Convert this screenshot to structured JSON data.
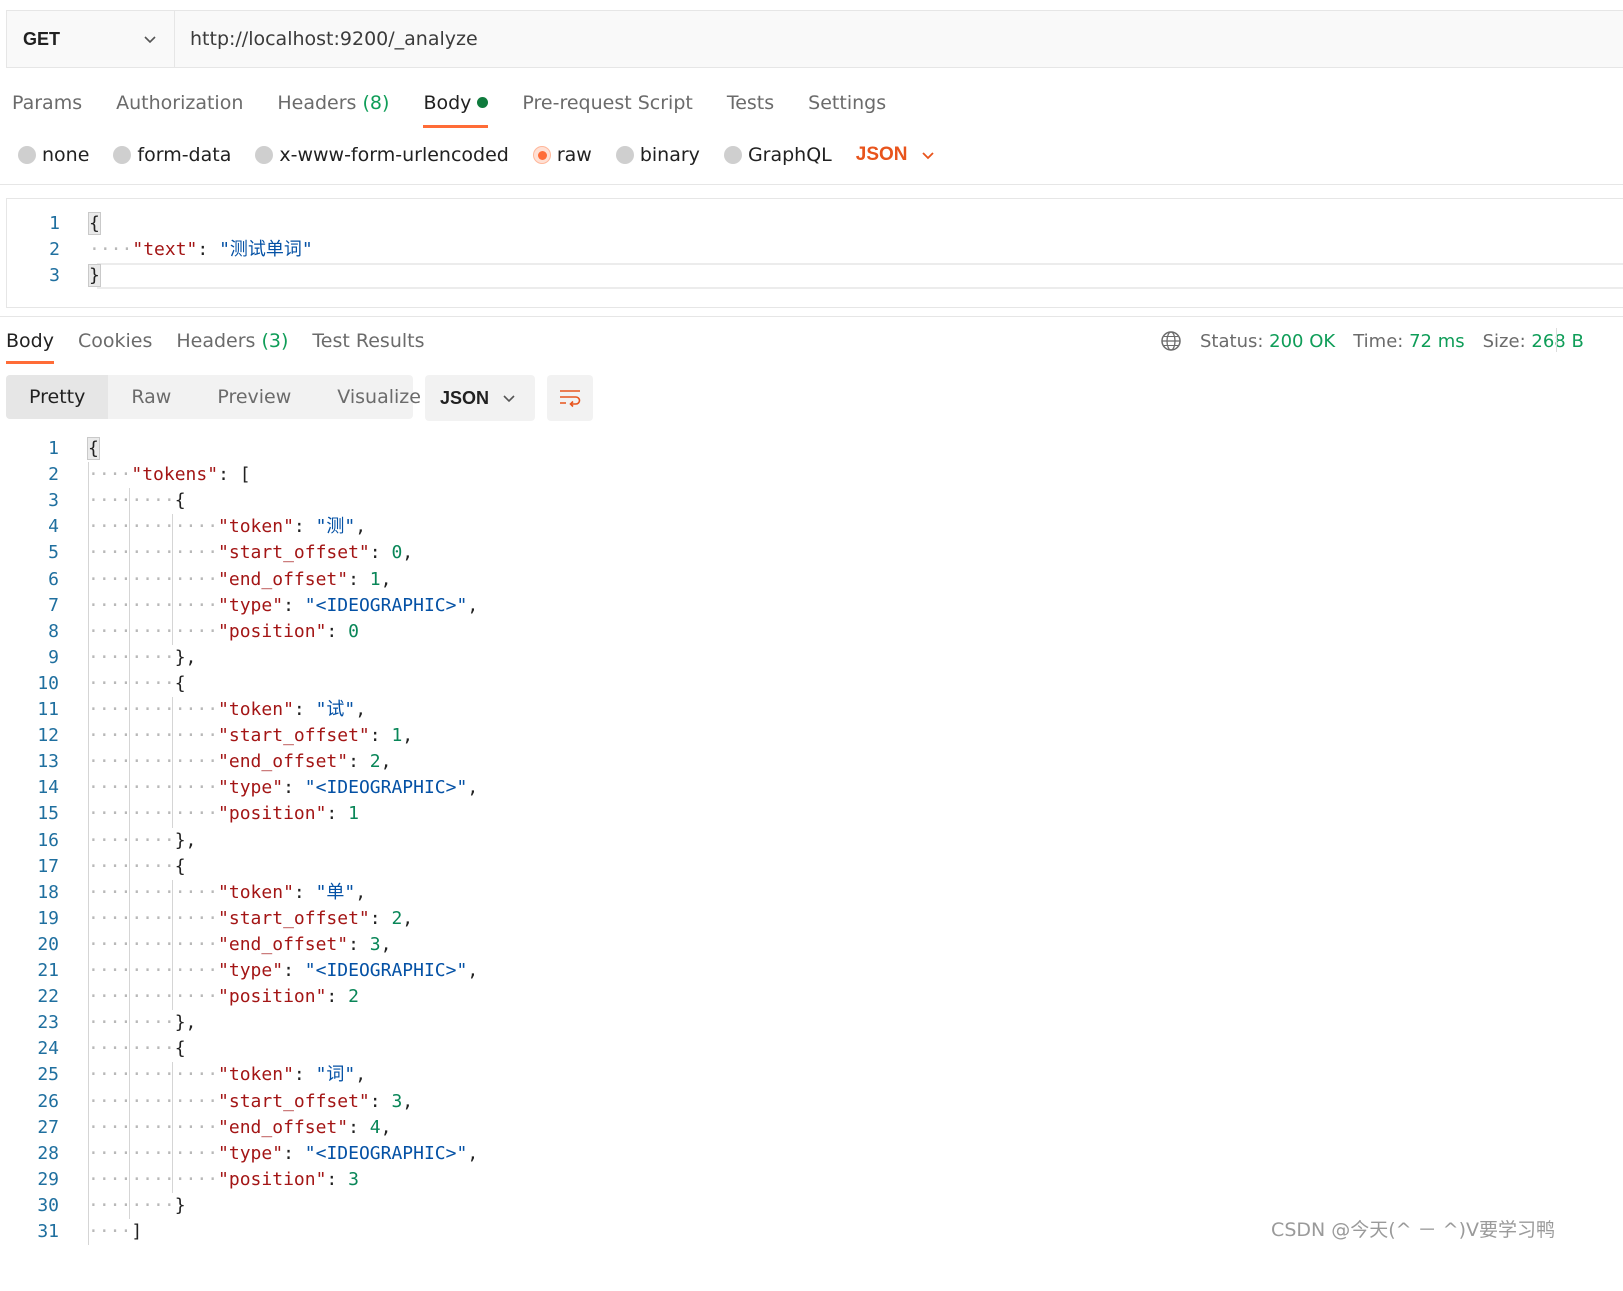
{
  "request": {
    "method": "GET",
    "url": "http://localhost:9200/_analyze"
  },
  "request_tabs": [
    {
      "label": "Params"
    },
    {
      "label": "Authorization"
    },
    {
      "label": "Headers",
      "count": "(8)"
    },
    {
      "label": "Body",
      "active": true
    },
    {
      "label": "Pre-request Script"
    },
    {
      "label": "Tests"
    },
    {
      "label": "Settings"
    }
  ],
  "body_types": [
    "none",
    "form-data",
    "x-www-form-urlencoded",
    "raw",
    "binary",
    "GraphQL"
  ],
  "body_type_selected": "raw",
  "body_language": "JSON",
  "request_body_lines": [
    {
      "indent": 0,
      "text": "{"
    },
    {
      "indent": 1,
      "key": "\"text\"",
      "value": "\"测试单词\""
    },
    {
      "indent": 0,
      "text": "}"
    }
  ],
  "response_tabs": [
    {
      "label": "Body",
      "active": true
    },
    {
      "label": "Cookies"
    },
    {
      "label": "Headers",
      "count": "(3)"
    },
    {
      "label": "Test Results"
    }
  ],
  "response_status": {
    "status_label": "Status:",
    "status_value": "200 OK",
    "time_label": "Time:",
    "time_value": "72 ms",
    "size_label": "Size:",
    "size_value": "268 B"
  },
  "view_modes": [
    "Pretty",
    "Raw",
    "Preview",
    "Visualize"
  ],
  "view_mode_active": "Pretty",
  "response_format": "JSON",
  "response_tokens": [
    {
      "token": "\"测\"",
      "start_offset": "0",
      "end_offset": "1",
      "type": "\"<IDEOGRAPHIC>\"",
      "position": "0"
    },
    {
      "token": "\"试\"",
      "start_offset": "1",
      "end_offset": "2",
      "type": "\"<IDEOGRAPHIC>\"",
      "position": "1"
    },
    {
      "token": "\"单\"",
      "start_offset": "2",
      "end_offset": "3",
      "type": "\"<IDEOGRAPHIC>\"",
      "position": "2"
    },
    {
      "token": "\"词\"",
      "start_offset": "3",
      "end_offset": "4",
      "type": "\"<IDEOGRAPHIC>\"",
      "position": "3"
    }
  ],
  "response_keys": {
    "tokens": "\"tokens\"",
    "token": "\"token\"",
    "start_offset": "\"start_offset\"",
    "end_offset": "\"end_offset\"",
    "type": "\"type\"",
    "position": "\"position\""
  },
  "watermark": "CSDN @今天(^ － ^)V要学习鸭",
  "colors": {
    "accent": "#ff6c37",
    "status_green": "#0f9d58",
    "json_key": "#a31515",
    "json_string": "#0451a5",
    "json_number": "#098658"
  }
}
